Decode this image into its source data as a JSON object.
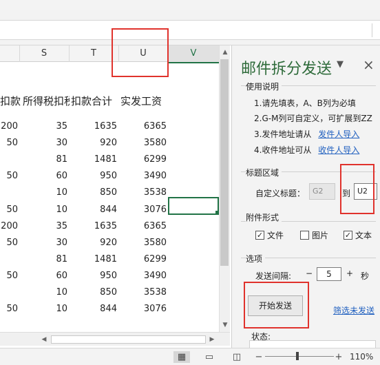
{
  "sheet": {
    "columns": [
      "",
      "S",
      "T",
      "U",
      "V"
    ],
    "headers": [
      "扣款",
      "所得税扣税",
      "扣款合计",
      "实发工资"
    ],
    "rows": [
      [
        "200",
        "35",
        "1635",
        "6365"
      ],
      [
        "50",
        "30",
        "920",
        "3580"
      ],
      [
        "",
        "81",
        "1481",
        "6299"
      ],
      [
        "50",
        "60",
        "950",
        "3490"
      ],
      [
        "",
        "10",
        "850",
        "3538"
      ],
      [
        "50",
        "10",
        "844",
        "3076"
      ],
      [
        "200",
        "35",
        "1635",
        "6365"
      ],
      [
        "50",
        "30",
        "920",
        "3580"
      ],
      [
        "",
        "81",
        "1481",
        "6299"
      ],
      [
        "50",
        "60",
        "950",
        "3490"
      ],
      [
        "",
        "10",
        "850",
        "3538"
      ],
      [
        "50",
        "10",
        "844",
        "3076"
      ]
    ]
  },
  "pane": {
    "title": "邮件拆分发送",
    "close": "×",
    "usage": {
      "label": "使用说明",
      "line1": "1.请先填表，A、B列为必填",
      "line2": "2.G-M列可自定义，可扩展到ZZ",
      "line3_text": "3.发件地址请从",
      "line3_link": "发件人导入",
      "line4_text": "4.收件地址可从",
      "line4_link": "收件人导入"
    },
    "title_area": {
      "label": "标题区域",
      "custom_label": "自定义标题：",
      "from_value": "G2",
      "to_label": "到",
      "to_value": "U2"
    },
    "attachment": {
      "label": "附件形式",
      "options": [
        {
          "label": "文件",
          "checked": true
        },
        {
          "label": "图片",
          "checked": false
        },
        {
          "label": "文本",
          "checked": true
        }
      ]
    },
    "options": {
      "label": "选项",
      "interval_label": "发送间隔:",
      "minus": "−",
      "value": "5",
      "plus": "+",
      "unit": "秒"
    },
    "start_button": "开始发送",
    "filter_link": "筛选未发送",
    "status_label": "状态:"
  },
  "statusbar": {
    "zoom_minus": "−",
    "zoom_plus": "+",
    "zoom": "110%"
  }
}
